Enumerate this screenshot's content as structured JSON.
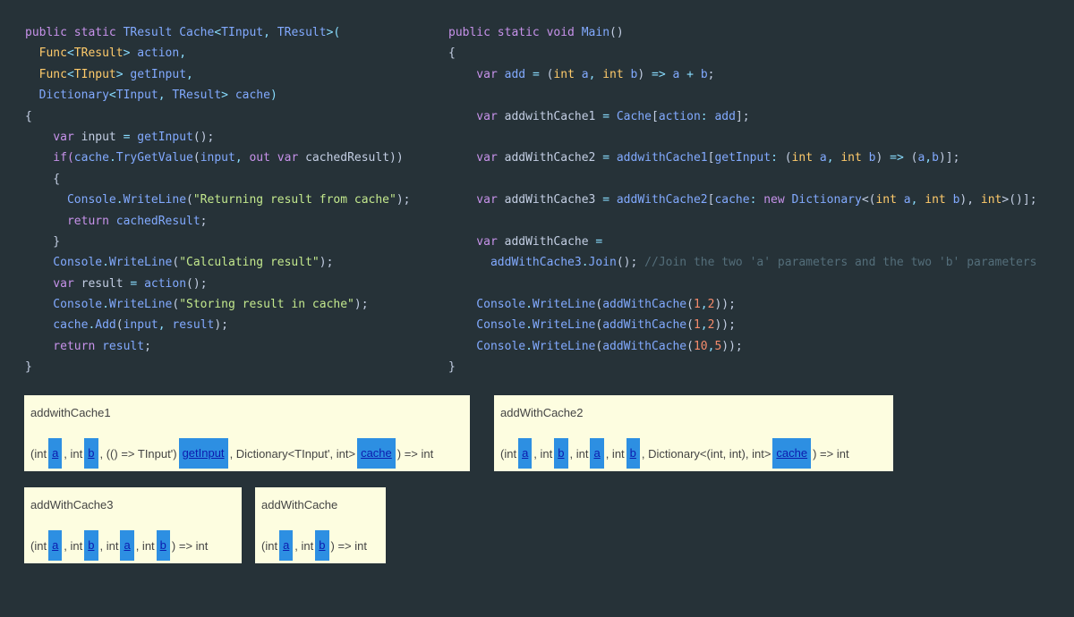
{
  "left_code": [
    [
      {
        "t": "public static ",
        "c": "keyword"
      },
      {
        "t": "TResult ",
        "c": "method"
      },
      {
        "t": "Cache",
        "c": "method"
      },
      {
        "t": "<",
        "c": "punct"
      },
      {
        "t": "TInput",
        "c": "method"
      },
      {
        "t": ", ",
        "c": "punct"
      },
      {
        "t": "TResult",
        "c": "method"
      },
      {
        "t": ">(",
        "c": "punct"
      }
    ],
    [
      {
        "t": "  Func",
        "c": "type"
      },
      {
        "t": "<",
        "c": "punct"
      },
      {
        "t": "TResult",
        "c": "type"
      },
      {
        "t": "> ",
        "c": "punct"
      },
      {
        "t": "action",
        "c": "method"
      },
      {
        "t": ",",
        "c": "punct"
      }
    ],
    [
      {
        "t": "  Func",
        "c": "type"
      },
      {
        "t": "<",
        "c": "punct"
      },
      {
        "t": "TInput",
        "c": "type"
      },
      {
        "t": "> ",
        "c": "punct"
      },
      {
        "t": "getInput",
        "c": "method"
      },
      {
        "t": ",",
        "c": "punct"
      }
    ],
    [
      {
        "t": "  Dictionary",
        "c": "method"
      },
      {
        "t": "<",
        "c": "punct"
      },
      {
        "t": "TInput",
        "c": "method"
      },
      {
        "t": ", ",
        "c": "punct"
      },
      {
        "t": "TResult",
        "c": "method"
      },
      {
        "t": "> ",
        "c": "punct"
      },
      {
        "t": "cache",
        "c": "method"
      },
      {
        "t": ")",
        "c": "punct"
      }
    ],
    [
      {
        "t": "{",
        "c": "plain"
      }
    ],
    [
      {
        "t": "    var ",
        "c": "keyword"
      },
      {
        "t": "input ",
        "c": "ident"
      },
      {
        "t": "= ",
        "c": "punct"
      },
      {
        "t": "getInput",
        "c": "method"
      },
      {
        "t": "();",
        "c": "plain"
      }
    ],
    [
      {
        "t": "    if(",
        "c": "keyword"
      },
      {
        "t": "cache",
        "c": "method"
      },
      {
        "t": ".",
        "c": "punct"
      },
      {
        "t": "TryGetValue",
        "c": "method"
      },
      {
        "t": "(",
        "c": "plain"
      },
      {
        "t": "input",
        "c": "method"
      },
      {
        "t": ", ",
        "c": "punct"
      },
      {
        "t": "out var ",
        "c": "keyword"
      },
      {
        "t": "cachedResult",
        "c": "ident"
      },
      {
        "t": "))",
        "c": "plain"
      }
    ],
    [
      {
        "t": "    {",
        "c": "plain"
      }
    ],
    [
      {
        "t": "      Console",
        "c": "method"
      },
      {
        "t": ".",
        "c": "punct"
      },
      {
        "t": "WriteLine",
        "c": "method"
      },
      {
        "t": "(",
        "c": "plain"
      },
      {
        "t": "\"Returning result from cache\"",
        "c": "string"
      },
      {
        "t": ");",
        "c": "plain"
      }
    ],
    [
      {
        "t": "      return ",
        "c": "keyword"
      },
      {
        "t": "cachedResult",
        "c": "method"
      },
      {
        "t": ";",
        "c": "plain"
      }
    ],
    [
      {
        "t": "    }",
        "c": "plain"
      }
    ],
    [
      {
        "t": "    Console",
        "c": "method"
      },
      {
        "t": ".",
        "c": "punct"
      },
      {
        "t": "WriteLine",
        "c": "method"
      },
      {
        "t": "(",
        "c": "plain"
      },
      {
        "t": "\"Calculating result\"",
        "c": "string"
      },
      {
        "t": ");",
        "c": "plain"
      }
    ],
    [
      {
        "t": "    var ",
        "c": "keyword"
      },
      {
        "t": "result ",
        "c": "ident"
      },
      {
        "t": "= ",
        "c": "punct"
      },
      {
        "t": "action",
        "c": "method"
      },
      {
        "t": "();",
        "c": "plain"
      }
    ],
    [
      {
        "t": "    Console",
        "c": "method"
      },
      {
        "t": ".",
        "c": "punct"
      },
      {
        "t": "WriteLine",
        "c": "method"
      },
      {
        "t": "(",
        "c": "plain"
      },
      {
        "t": "\"Storing result in cache\"",
        "c": "string"
      },
      {
        "t": ");",
        "c": "plain"
      }
    ],
    [
      {
        "t": "    cache",
        "c": "method"
      },
      {
        "t": ".",
        "c": "punct"
      },
      {
        "t": "Add",
        "c": "method"
      },
      {
        "t": "(",
        "c": "plain"
      },
      {
        "t": "input",
        "c": "method"
      },
      {
        "t": ", ",
        "c": "punct"
      },
      {
        "t": "result",
        "c": "method"
      },
      {
        "t": ");",
        "c": "plain"
      }
    ],
    [
      {
        "t": "    return ",
        "c": "keyword"
      },
      {
        "t": "result",
        "c": "method"
      },
      {
        "t": ";",
        "c": "plain"
      }
    ],
    [
      {
        "t": "}",
        "c": "plain"
      }
    ]
  ],
  "right_code": [
    [
      {
        "t": "public static void ",
        "c": "keyword"
      },
      {
        "t": "Main",
        "c": "method"
      },
      {
        "t": "()",
        "c": "plain"
      }
    ],
    [
      {
        "t": "{",
        "c": "plain"
      }
    ],
    [
      {
        "t": "    var ",
        "c": "keyword"
      },
      {
        "t": "add ",
        "c": "method"
      },
      {
        "t": "= ",
        "c": "punct"
      },
      {
        "t": "(",
        "c": "plain"
      },
      {
        "t": "int ",
        "c": "type"
      },
      {
        "t": "a",
        "c": "method"
      },
      {
        "t": ", ",
        "c": "punct"
      },
      {
        "t": "int ",
        "c": "type"
      },
      {
        "t": "b",
        "c": "method"
      },
      {
        "t": ") ",
        "c": "plain"
      },
      {
        "t": "=> ",
        "c": "punct"
      },
      {
        "t": "a ",
        "c": "method"
      },
      {
        "t": "+ ",
        "c": "punct"
      },
      {
        "t": "b",
        "c": "method"
      },
      {
        "t": ";",
        "c": "plain"
      }
    ],
    [],
    [
      {
        "t": "    var ",
        "c": "keyword"
      },
      {
        "t": "addwithCache1 ",
        "c": "ident"
      },
      {
        "t": "= ",
        "c": "punct"
      },
      {
        "t": "Cache",
        "c": "method"
      },
      {
        "t": "[",
        "c": "plain"
      },
      {
        "t": "action",
        "c": "method"
      },
      {
        "t": ": ",
        "c": "punct"
      },
      {
        "t": "add",
        "c": "method"
      },
      {
        "t": "];",
        "c": "plain"
      }
    ],
    [],
    [
      {
        "t": "    var ",
        "c": "keyword"
      },
      {
        "t": "addWithCache2 ",
        "c": "ident"
      },
      {
        "t": "= ",
        "c": "punct"
      },
      {
        "t": "addwithCache1",
        "c": "method"
      },
      {
        "t": "[",
        "c": "plain"
      },
      {
        "t": "getInput",
        "c": "method"
      },
      {
        "t": ": ",
        "c": "punct"
      },
      {
        "t": "(",
        "c": "plain"
      },
      {
        "t": "int ",
        "c": "type"
      },
      {
        "t": "a",
        "c": "method"
      },
      {
        "t": ", ",
        "c": "punct"
      },
      {
        "t": "int ",
        "c": "type"
      },
      {
        "t": "b",
        "c": "method"
      },
      {
        "t": ") ",
        "c": "plain"
      },
      {
        "t": "=> ",
        "c": "punct"
      },
      {
        "t": "(",
        "c": "plain"
      },
      {
        "t": "a",
        "c": "method"
      },
      {
        "t": ",",
        "c": "punct"
      },
      {
        "t": "b",
        "c": "method"
      },
      {
        "t": ")];",
        "c": "plain"
      }
    ],
    [],
    [
      {
        "t": "    var ",
        "c": "keyword"
      },
      {
        "t": "addWithCache3 ",
        "c": "ident"
      },
      {
        "t": "= ",
        "c": "punct"
      },
      {
        "t": "addWithCache2",
        "c": "method"
      },
      {
        "t": "[",
        "c": "plain"
      },
      {
        "t": "cache",
        "c": "method"
      },
      {
        "t": ": ",
        "c": "punct"
      },
      {
        "t": "new ",
        "c": "keyword"
      },
      {
        "t": "Dictionary",
        "c": "method"
      },
      {
        "t": "<(",
        "c": "plain"
      },
      {
        "t": "int ",
        "c": "type"
      },
      {
        "t": "a",
        "c": "method"
      },
      {
        "t": ", ",
        "c": "punct"
      },
      {
        "t": "int ",
        "c": "type"
      },
      {
        "t": "b",
        "c": "method"
      },
      {
        "t": "), ",
        "c": "plain"
      },
      {
        "t": "int",
        "c": "type"
      },
      {
        "t": ">()];",
        "c": "plain"
      }
    ],
    [],
    [
      {
        "t": "    var ",
        "c": "keyword"
      },
      {
        "t": "addWithCache ",
        "c": "ident"
      },
      {
        "t": "=",
        "c": "punct"
      }
    ],
    [
      {
        "t": "      addWithCache3",
        "c": "method"
      },
      {
        "t": ".",
        "c": "punct"
      },
      {
        "t": "Join",
        "c": "method"
      },
      {
        "t": "(); ",
        "c": "plain"
      },
      {
        "t": "//Join the two 'a' parameters and the two 'b' parameters",
        "c": "comment"
      }
    ],
    [],
    [
      {
        "t": "    Console",
        "c": "method"
      },
      {
        "t": ".",
        "c": "punct"
      },
      {
        "t": "WriteLine",
        "c": "method"
      },
      {
        "t": "(",
        "c": "plain"
      },
      {
        "t": "addWithCache",
        "c": "method"
      },
      {
        "t": "(",
        "c": "plain"
      },
      {
        "t": "1",
        "c": "number"
      },
      {
        "t": ",",
        "c": "punct"
      },
      {
        "t": "2",
        "c": "number"
      },
      {
        "t": "));",
        "c": "plain"
      }
    ],
    [
      {
        "t": "    Console",
        "c": "method"
      },
      {
        "t": ".",
        "c": "punct"
      },
      {
        "t": "WriteLine",
        "c": "method"
      },
      {
        "t": "(",
        "c": "plain"
      },
      {
        "t": "addWithCache",
        "c": "method"
      },
      {
        "t": "(",
        "c": "plain"
      },
      {
        "t": "1",
        "c": "number"
      },
      {
        "t": ",",
        "c": "punct"
      },
      {
        "t": "2",
        "c": "number"
      },
      {
        "t": "));",
        "c": "plain"
      }
    ],
    [
      {
        "t": "    Console",
        "c": "method"
      },
      {
        "t": ".",
        "c": "punct"
      },
      {
        "t": "WriteLine",
        "c": "method"
      },
      {
        "t": "(",
        "c": "plain"
      },
      {
        "t": "addWithCache",
        "c": "method"
      },
      {
        "t": "(",
        "c": "plain"
      },
      {
        "t": "10",
        "c": "number"
      },
      {
        "t": ",",
        "c": "punct"
      },
      {
        "t": "5",
        "c": "number"
      },
      {
        "t": "));",
        "c": "plain"
      }
    ],
    [
      {
        "t": "}",
        "c": "plain"
      }
    ]
  ],
  "tooltips": [
    {
      "title": "addwithCache1",
      "signature": [
        {
          "t": "(int "
        },
        {
          "t": "a",
          "hl": true
        },
        {
          "t": ", int "
        },
        {
          "t": "b",
          "hl": true
        },
        {
          "t": ", (() => TInput')"
        },
        {
          "t": "getInput",
          "hl": true
        },
        {
          "t": ", Dictionary<TInput', int>"
        },
        {
          "t": "cache",
          "hl": true
        },
        {
          "t": ") => int"
        }
      ]
    },
    {
      "title": "addWithCache2",
      "signature": [
        {
          "t": "(int "
        },
        {
          "t": "a",
          "hl": true
        },
        {
          "t": ", int "
        },
        {
          "t": "b",
          "hl": true
        },
        {
          "t": ", int "
        },
        {
          "t": "a",
          "hl": true
        },
        {
          "t": ", int "
        },
        {
          "t": "b",
          "hl": true
        },
        {
          "t": ", Dictionary<(int, int), int>"
        },
        {
          "t": "cache",
          "hl": true
        },
        {
          "t": ") => int"
        }
      ]
    },
    {
      "title": "addWithCache3",
      "signature": [
        {
          "t": "(int "
        },
        {
          "t": "a",
          "hl": true
        },
        {
          "t": ", int "
        },
        {
          "t": "b",
          "hl": true
        },
        {
          "t": ", int "
        },
        {
          "t": "a",
          "hl": true
        },
        {
          "t": ", int "
        },
        {
          "t": "b",
          "hl": true
        },
        {
          "t": ") => int"
        }
      ]
    },
    {
      "title": "addWithCache",
      "signature": [
        {
          "t": "(int "
        },
        {
          "t": "a",
          "hl": true
        },
        {
          "t": ", int "
        },
        {
          "t": "b",
          "hl": true
        },
        {
          "t": ") => int"
        }
      ]
    }
  ],
  "colors": {
    "background": "#263238",
    "tooltip_bg": "#fdfde0",
    "param_highlight": "#2d8fe2"
  }
}
